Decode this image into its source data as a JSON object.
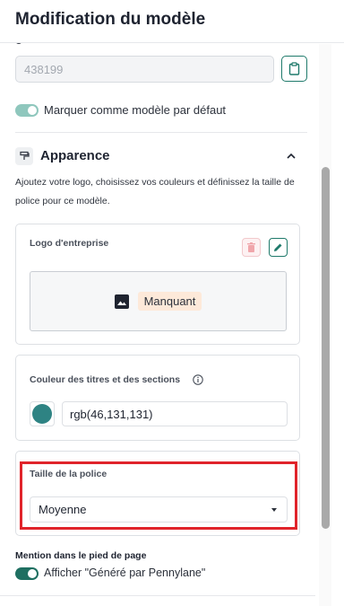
{
  "header": {
    "title": "Modification du modèle"
  },
  "template_id": {
    "value": "438199",
    "peek_text": "g"
  },
  "default_toggle": {
    "label": "Marquer comme modèle par défaut",
    "checked": true
  },
  "appearance": {
    "title": "Apparence",
    "icon": "paint-icon",
    "description": "Ajoutez votre logo, choisissez vos couleurs et définissez la taille de police pour ce modèle.",
    "logo": {
      "label": "Logo d'entreprise",
      "missing_badge": "Manquant"
    },
    "color": {
      "label": "Couleur des titres et des sections",
      "value": "rgb(46,131,131)",
      "swatch": "#2e8383"
    },
    "font_size": {
      "label": "Taille de la police",
      "selected": "Moyenne"
    }
  },
  "footer_mention": {
    "title": "Mention dans le pied de page",
    "toggle_label": "Afficher \"Généré par Pennylane\"",
    "checked": true
  },
  "colors": {
    "accent": "#1f7a6b",
    "highlight": "#e0242b"
  }
}
